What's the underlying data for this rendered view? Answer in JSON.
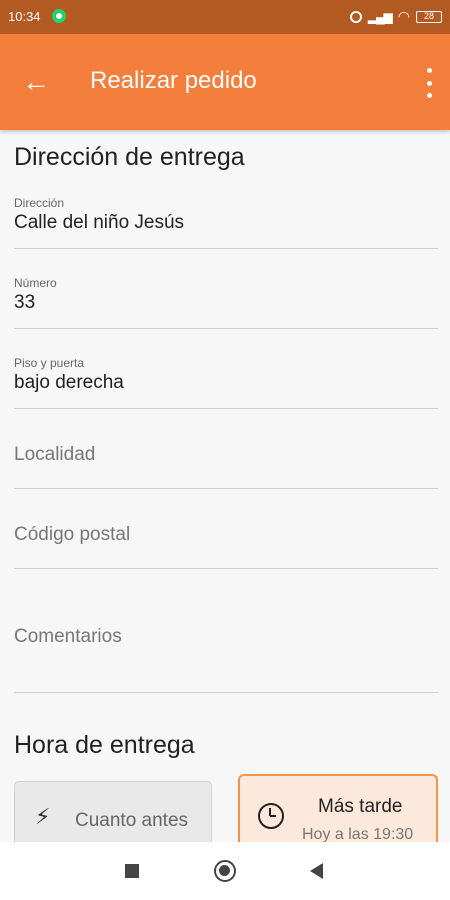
{
  "status_bar": {
    "time": "10:34",
    "battery": "28"
  },
  "app_bar": {
    "title": "Realizar pedido"
  },
  "address_section": {
    "title": "Dirección de entrega"
  },
  "fields": {
    "direccion": {
      "label": "Dirección",
      "value": "Calle del niño Jesús"
    },
    "numero": {
      "label": "Número",
      "value": "33"
    },
    "piso": {
      "label": "Piso y puerta",
      "value": "bajo derecha"
    },
    "localidad": {
      "placeholder": "Localidad"
    },
    "codigo_postal": {
      "placeholder": "Código postal"
    },
    "comentarios": {
      "placeholder": "Comentarios"
    }
  },
  "delivery_time_section": {
    "title": "Hora de entrega",
    "asap_label": "Cuanto antes",
    "later_label": "Más tarde",
    "later_sub": "Hoy a las 19:30"
  },
  "colors": {
    "accent": "#f47f3d",
    "status_bar": "#b35a22",
    "selected_bg": "#fde9db"
  }
}
